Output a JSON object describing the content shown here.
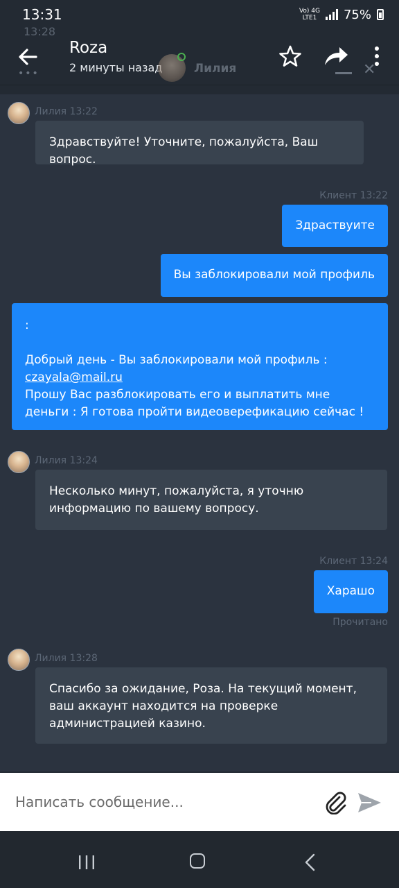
{
  "status": {
    "time": "13:31",
    "network_top": "Vo) 4G",
    "network_bottom": "LTE1",
    "battery": "75%"
  },
  "header": {
    "background_time": "13:28",
    "title": "Roza",
    "subtitle": "2 минуты назад",
    "background_agent": "Лилия"
  },
  "messages": [
    {
      "side": "in",
      "meta": "Лилия 13:22",
      "text": "Здравствуйте! Уточните, пожалуйста, Ваш вопрос."
    },
    {
      "side": "out",
      "meta": "Клиент 13:22",
      "text": "Здраствуите"
    },
    {
      "side": "out",
      "text": "Вы заблокировали мой профиль"
    },
    {
      "side": "out",
      "text_before": ":\n\nДобрый день - Вы заблокировали мой профиль :",
      "link": "czayala@mail.ru",
      "text_after": "Прошу Вас разблокировать его и выплатить мне деньги : Я готова пройти видеоверефикацию сейчас !"
    },
    {
      "side": "in",
      "meta": "Лилия 13:24",
      "text": "Несколько минут, пожалуйста, я уточню информацию по вашему вопросу."
    },
    {
      "side": "out",
      "meta": "Клиент 13:24",
      "text": "Харашо",
      "status": "Прочитано"
    },
    {
      "side": "in",
      "meta": "Лилия 13:28",
      "text": "Спасибо за ожидание, Роза. На текущий момент, ваш аккаунт находится на проверке администрацией казино."
    }
  ],
  "composer": {
    "placeholder": "Написать сообщение..."
  },
  "icons": {
    "back": "arrow-left-icon",
    "star": "star-icon",
    "share": "share-icon",
    "more": "more-vertical-icon",
    "attach": "paperclip-icon",
    "send": "send-icon"
  },
  "colors": {
    "outgoing_bubble": "#1c87fa",
    "incoming_bubble": "#39434f",
    "chat_background": "#2b333f",
    "meta_text": "#5c6776"
  }
}
